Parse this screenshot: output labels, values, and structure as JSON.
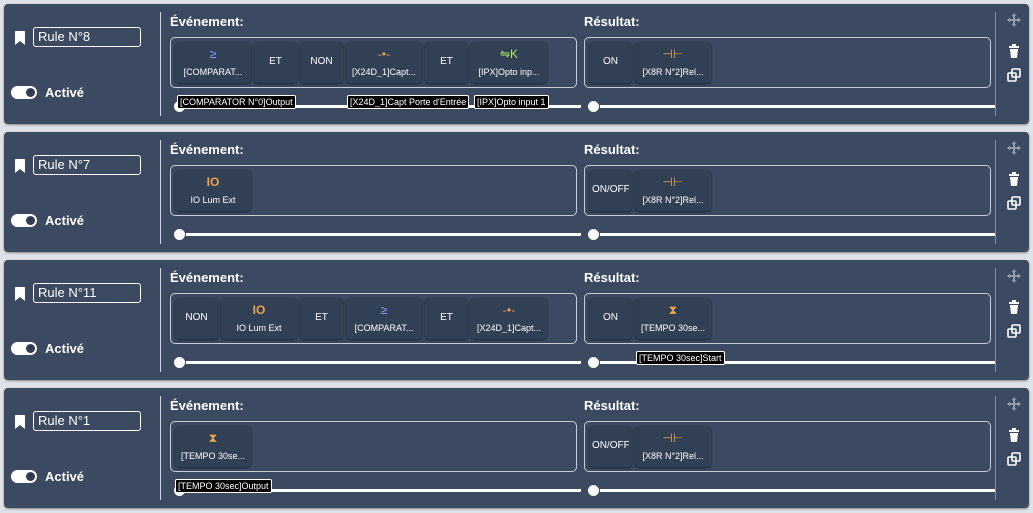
{
  "labels": {
    "event": "Événement:",
    "result": "Résultat:",
    "active": "Activé"
  },
  "colors": {
    "card_bg": "#3b4a60",
    "block_bg": "#324055",
    "accent_orange": "#f0a44a",
    "accent_blue": "#8aa0ff",
    "accent_green": "#b6e36a"
  },
  "rules": [
    {
      "name": "Rule N°8",
      "event_blocks": [
        {
          "icon": "greater-equal-icon",
          "label": "[COMPARAT..."
        },
        {
          "label": "ET"
        },
        {
          "label": "NON"
        },
        {
          "icon": "sensor-icon",
          "label": "[X24D_1]Capt..."
        },
        {
          "label": "ET"
        },
        {
          "icon": "opto-icon",
          "label": "[IPX]Opto inp..."
        }
      ],
      "result_blocks": [
        {
          "label": "ON"
        },
        {
          "icon": "relay-icon",
          "label": "[X8R N°2]Rel..."
        }
      ],
      "event_tags": [
        "[COMPARATOR N°0]Output",
        "[X24D_1]Capt Porte d'Entrée",
        "[IPX]Opto input 1"
      ],
      "result_tags": []
    },
    {
      "name": "Rule N°7",
      "event_blocks": [
        {
          "icon": "io-icon",
          "label": "IO Lum Ext"
        }
      ],
      "result_blocks": [
        {
          "label": "ON/OFF"
        },
        {
          "icon": "relay-icon",
          "label": "[X8R N°2]Rel..."
        }
      ],
      "event_tags": [],
      "result_tags": []
    },
    {
      "name": "Rule N°11",
      "event_blocks": [
        {
          "label": "NON"
        },
        {
          "icon": "io-icon",
          "label": "IO Lum Ext"
        },
        {
          "label": "ET"
        },
        {
          "icon": "greater-equal-icon",
          "label": "[COMPARAT..."
        },
        {
          "label": "ET"
        },
        {
          "icon": "sensor-icon",
          "label": "[X24D_1]Capt..."
        }
      ],
      "result_blocks": [
        {
          "label": "ON"
        },
        {
          "icon": "hourglass-icon",
          "label": "[TEMPO 30se..."
        }
      ],
      "event_tags": [],
      "result_tags": [
        "[TEMPO 30sec]Start"
      ]
    },
    {
      "name": "Rule N°1",
      "event_blocks": [
        {
          "icon": "hourglass-icon",
          "label": "[TEMPO 30se..."
        }
      ],
      "result_blocks": [
        {
          "label": "ON/OFF"
        },
        {
          "icon": "relay-icon",
          "label": "[X8R N°2]Rel..."
        }
      ],
      "event_tags": [
        "[TEMPO 30sec]Output"
      ],
      "result_tags": []
    }
  ]
}
